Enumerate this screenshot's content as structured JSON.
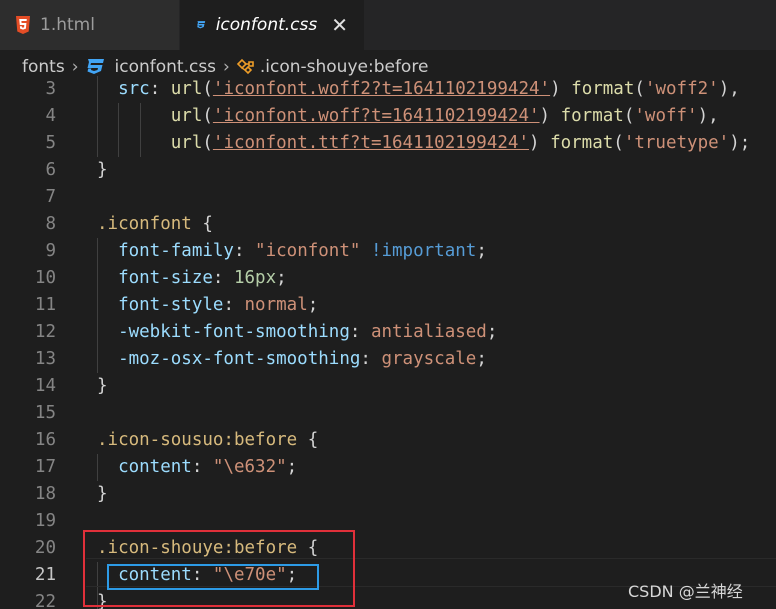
{
  "tabs": [
    {
      "label": "1.html",
      "icon": "html5-icon",
      "active": false
    },
    {
      "label": "iconfont.css",
      "icon": "css-icon",
      "active": true,
      "close": "✕"
    }
  ],
  "breadcrumb": {
    "folder": "fonts",
    "sep": "›",
    "file": "iconfont.css",
    "symbol": ".icon-shouye:before"
  },
  "colors": {
    "html_icon": "#e44d26",
    "css_icon": "#42a5f5",
    "annotation_red": "#e0303a",
    "annotation_blue": "#2d9be6"
  },
  "editor": {
    "lines": [
      {
        "n": "3",
        "tokens": [
          [
            "  src",
            "prop"
          ],
          [
            ": ",
            "punc"
          ],
          [
            "url",
            "fn"
          ],
          [
            "(",
            "punc"
          ],
          [
            "'iconfont.woff2?t=1641102199424'",
            "str url"
          ],
          [
            ") ",
            "punc"
          ],
          [
            "format",
            "fn"
          ],
          [
            "(",
            "punc"
          ],
          [
            "'woff2'",
            "str"
          ],
          [
            "),",
            "punc"
          ]
        ]
      },
      {
        "n": "4",
        "tokens": [
          [
            "       url",
            "fn"
          ],
          [
            "(",
            "punc"
          ],
          [
            "'iconfont.woff?t=1641102199424'",
            "str url"
          ],
          [
            ") ",
            "punc"
          ],
          [
            "format",
            "fn"
          ],
          [
            "(",
            "punc"
          ],
          [
            "'woff'",
            "str"
          ],
          [
            "),",
            "punc"
          ]
        ]
      },
      {
        "n": "5",
        "tokens": [
          [
            "       url",
            "fn"
          ],
          [
            "(",
            "punc"
          ],
          [
            "'iconfont.ttf?t=1641102199424'",
            "str url"
          ],
          [
            ") ",
            "punc"
          ],
          [
            "format",
            "fn"
          ],
          [
            "(",
            "punc"
          ],
          [
            "'truetype'",
            "str"
          ],
          [
            ");",
            "punc"
          ]
        ]
      },
      {
        "n": "6",
        "tokens": [
          [
            "}",
            "punc"
          ]
        ]
      },
      {
        "n": "7",
        "tokens": []
      },
      {
        "n": "8",
        "tokens": [
          [
            ".iconfont",
            "sel"
          ],
          [
            " {",
            "punc"
          ]
        ]
      },
      {
        "n": "9",
        "tokens": [
          [
            "  font-family",
            "prop"
          ],
          [
            ": ",
            "punc"
          ],
          [
            "\"iconfont\"",
            "str"
          ],
          [
            " ",
            "punc"
          ],
          [
            "!important",
            "kw"
          ],
          [
            ";",
            "punc"
          ]
        ]
      },
      {
        "n": "10",
        "tokens": [
          [
            "  font-size",
            "prop"
          ],
          [
            ": ",
            "punc"
          ],
          [
            "16px",
            "num"
          ],
          [
            ";",
            "punc"
          ]
        ]
      },
      {
        "n": "11",
        "tokens": [
          [
            "  font-style",
            "prop"
          ],
          [
            ": ",
            "punc"
          ],
          [
            "normal",
            "str"
          ],
          [
            ";",
            "punc"
          ]
        ]
      },
      {
        "n": "12",
        "tokens": [
          [
            "  -webkit-font-smoothing",
            "prop"
          ],
          [
            ": ",
            "punc"
          ],
          [
            "antialiased",
            "str"
          ],
          [
            ";",
            "punc"
          ]
        ]
      },
      {
        "n": "13",
        "tokens": [
          [
            "  -moz-osx-font-smoothing",
            "prop"
          ],
          [
            ": ",
            "punc"
          ],
          [
            "grayscale",
            "str"
          ],
          [
            ";",
            "punc"
          ]
        ]
      },
      {
        "n": "14",
        "tokens": [
          [
            "}",
            "punc"
          ]
        ]
      },
      {
        "n": "15",
        "tokens": []
      },
      {
        "n": "16",
        "tokens": [
          [
            ".icon-sousuo:before",
            "sel"
          ],
          [
            " {",
            "punc"
          ]
        ]
      },
      {
        "n": "17",
        "tokens": [
          [
            "  content",
            "prop"
          ],
          [
            ": ",
            "punc"
          ],
          [
            "\"\\e632\"",
            "str"
          ],
          [
            ";",
            "punc"
          ]
        ]
      },
      {
        "n": "18",
        "tokens": [
          [
            "}",
            "punc"
          ]
        ]
      },
      {
        "n": "19",
        "tokens": []
      },
      {
        "n": "20",
        "tokens": [
          [
            ".icon-shouye:before",
            "sel"
          ],
          [
            " {",
            "punc"
          ]
        ]
      },
      {
        "n": "21",
        "tokens": [
          [
            "  content",
            "prop"
          ],
          [
            ": ",
            "punc"
          ],
          [
            "\"\\e70e\"",
            "str"
          ],
          [
            ";",
            "punc"
          ]
        ],
        "current": true
      },
      {
        "n": "22",
        "tokens": [
          [
            "}",
            "punc"
          ]
        ]
      }
    ]
  },
  "watermark": "CSDN @兰神经"
}
